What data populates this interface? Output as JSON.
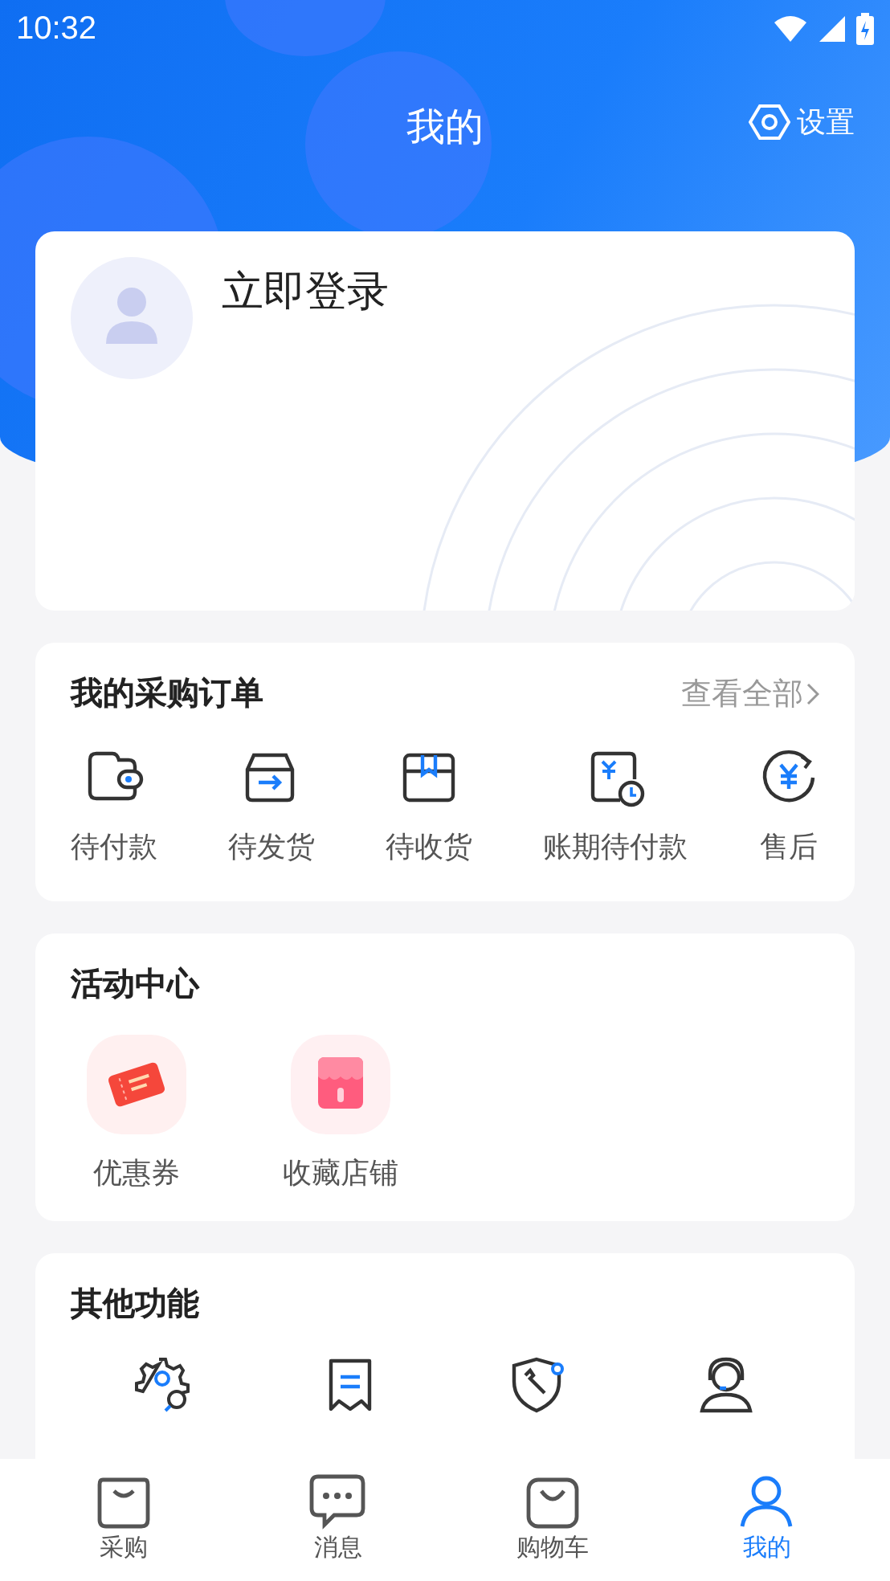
{
  "status_bar": {
    "time": "10:32"
  },
  "header": {
    "title": "我的",
    "settings": "设置"
  },
  "profile": {
    "login": "立即登录"
  },
  "orders": {
    "title": "我的采购订单",
    "view_all": "查看全部",
    "items": [
      {
        "kind": "wallet",
        "label": "待付款"
      },
      {
        "kind": "ship",
        "label": "待发货"
      },
      {
        "kind": "box",
        "label": "待收货"
      },
      {
        "kind": "credit",
        "label": "账期待付款"
      },
      {
        "kind": "refund",
        "label": "售后"
      }
    ]
  },
  "activities": {
    "title": "活动中心",
    "items": [
      {
        "kind": "coupon",
        "label": "优惠券"
      },
      {
        "kind": "store",
        "label": "收藏店铺"
      }
    ]
  },
  "other": {
    "title": "其他功能",
    "items": [
      {
        "kind": "gear"
      },
      {
        "kind": "receipt"
      },
      {
        "kind": "shield"
      },
      {
        "kind": "agent"
      }
    ]
  },
  "tab_bar": [
    {
      "kind": "bag",
      "label": "采购",
      "selected": false
    },
    {
      "kind": "chat",
      "label": "消息",
      "selected": false
    },
    {
      "kind": "cart",
      "label": "购物车",
      "selected": false
    },
    {
      "kind": "user",
      "label": "我的",
      "selected": true
    }
  ]
}
